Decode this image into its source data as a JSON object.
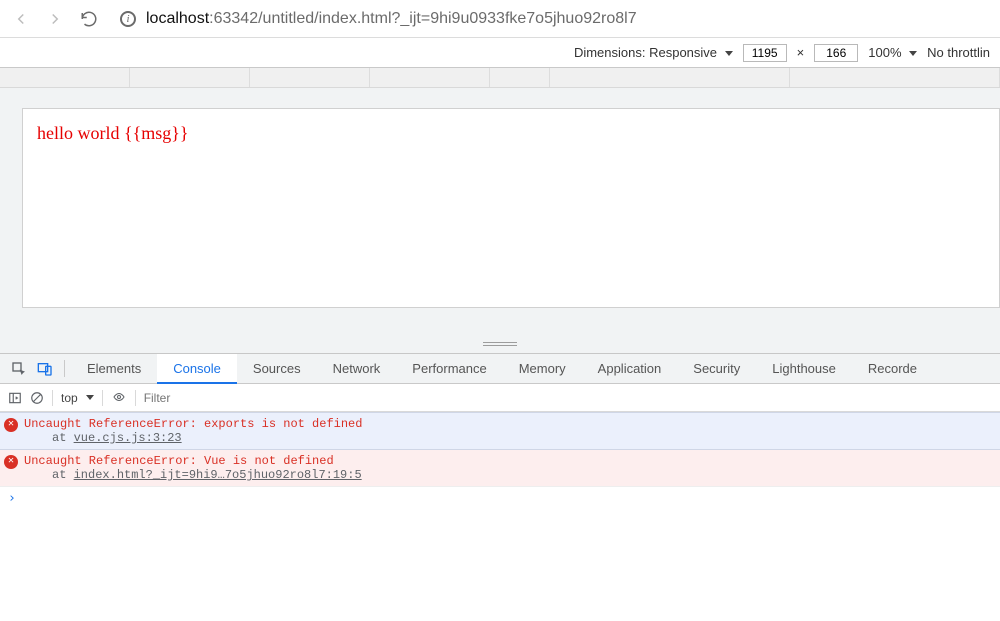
{
  "url": {
    "host": "localhost",
    "rest": ":63342/untitled/index.html?_ijt=9hi9u0933fke7o5jhuo92ro8l7"
  },
  "device_toolbar": {
    "dimensions_label": "Dimensions: Responsive",
    "width": "1195",
    "height": "166",
    "zoom": "100%",
    "throttling": "No throttlin"
  },
  "page": {
    "content": "hello world {{msg}}"
  },
  "devtools": {
    "tabs": {
      "elements": "Elements",
      "console": "Console",
      "sources": "Sources",
      "network": "Network",
      "performance": "Performance",
      "memory": "Memory",
      "application": "Application",
      "security": "Security",
      "lighthouse": "Lighthouse",
      "recorder": "Recorde"
    },
    "console_toolbar": {
      "context": "top",
      "filter_placeholder": "Filter"
    },
    "messages": [
      {
        "text": "Uncaught ReferenceError: exports is not defined",
        "stack_prefix": "at ",
        "stack_link": "vue.cjs.js:3:23"
      },
      {
        "text": "Uncaught ReferenceError: Vue is not defined",
        "stack_prefix": "at ",
        "stack_link": "index.html?_ijt=9hi9…7o5jhuo92ro8l7:19:5"
      }
    ]
  }
}
